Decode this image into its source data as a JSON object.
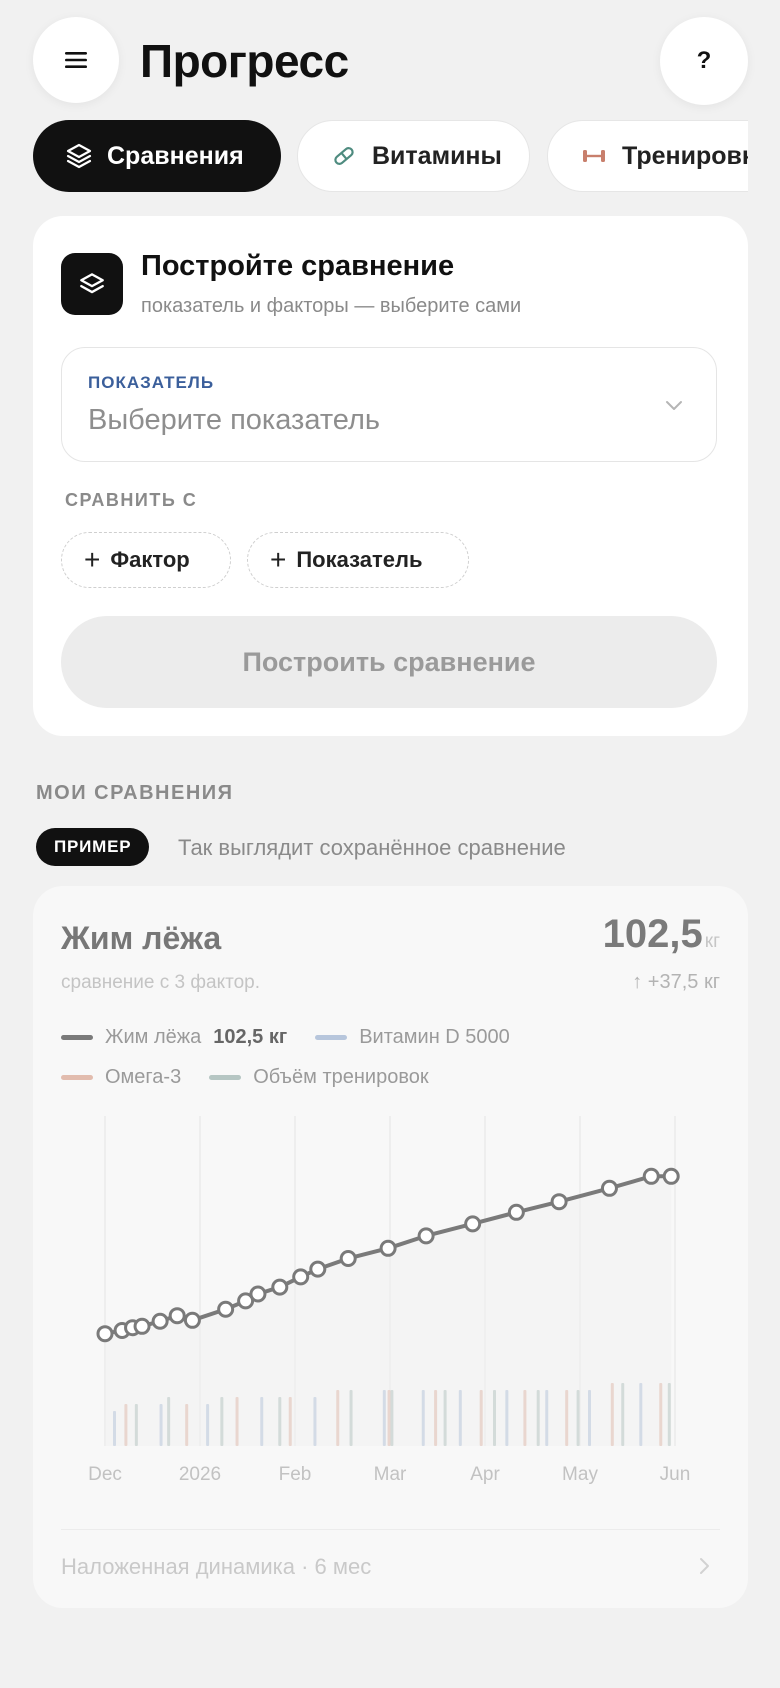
{
  "header": {
    "title": "Прогресс",
    "help": "?"
  },
  "tabs": [
    {
      "label": "Сравнения",
      "icon": "layers-icon"
    },
    {
      "label": "Витамины",
      "icon": "pill-icon"
    },
    {
      "label": "Тренировки",
      "icon": "dumbbell-icon"
    }
  ],
  "builder": {
    "title": "Постройте сравнение",
    "subtitle": "показатель и факторы — выберите сами",
    "metric_label": "ПОКАЗАТЕЛЬ",
    "metric_placeholder": "Выберите показатель",
    "compare_label": "СРАВНИТЬ С",
    "add_factor": "Фактор",
    "add_metric": "Показатель",
    "build_button": "Построить сравнение"
  },
  "my_comparisons": {
    "section_label": "МОИ СРАВНЕНИЯ",
    "badge": "ПРИМЕР",
    "note": "Так выглядит сохранённое сравнение"
  },
  "example": {
    "title": "Жим лёжа",
    "subtitle": "сравнение с 3 фактор.",
    "value": "102,5",
    "unit": "кг",
    "delta": "↑ +37,5 кг",
    "legend": [
      {
        "name": "Жим лёжа",
        "value": "102,5 кг",
        "color": "#7a7a7a"
      },
      {
        "name": "Витамин D 5000",
        "color": "#b7c6dc"
      },
      {
        "name": "Омега-3",
        "color": "#e2bcae"
      },
      {
        "name": "Объём тренировок",
        "color": "#b6c6c3"
      }
    ],
    "footer": "Наложенная динамика · 6 мес"
  },
  "chart_data": {
    "type": "line",
    "x_tick_labels": [
      "Dec",
      "2026",
      "Feb",
      "Mar",
      "Apr",
      "May",
      "Jun"
    ],
    "series": [
      {
        "name": "Жим лёжа",
        "x": [
          0.0,
          0.18,
          0.29,
          0.39,
          0.58,
          0.76,
          0.92,
          1.27,
          1.48,
          1.61,
          1.84,
          2.06,
          2.24,
          2.56,
          2.98,
          3.38,
          3.87,
          4.33,
          4.78,
          5.31,
          5.75,
          5.96
        ],
        "values": [
          65.0,
          65.7,
          66.3,
          66.6,
          67.7,
          68.9,
          67.9,
          70.3,
          72.1,
          73.6,
          75.1,
          77.3,
          79.0,
          81.3,
          83.5,
          86.2,
          88.8,
          91.3,
          93.6,
          96.5,
          99.1,
          99.1
        ]
      },
      {
        "name": "Витамин D 5000",
        "x": [
          0.1,
          0.59,
          1.08,
          1.65,
          2.21,
          2.94,
          3.35,
          3.74,
          4.23,
          4.65,
          5.1,
          5.64
        ],
        "values": [
          0.5,
          0.6,
          0.6,
          0.7,
          0.7,
          0.8,
          0.8,
          0.8,
          0.8,
          0.8,
          0.8,
          0.9
        ]
      },
      {
        "name": "Омега-3",
        "x": [
          0.22,
          0.86,
          1.39,
          1.95,
          2.45,
          2.99,
          3.48,
          3.96,
          4.42,
          4.86,
          5.34,
          5.85
        ],
        "values": [
          0.6,
          0.6,
          0.7,
          0.7,
          0.8,
          0.8,
          0.8,
          0.8,
          0.8,
          0.8,
          0.9,
          0.9
        ]
      },
      {
        "name": "Объём тренировок",
        "x": [
          0.33,
          0.67,
          1.23,
          1.84,
          2.59,
          3.02,
          3.58,
          4.1,
          4.56,
          4.98,
          5.45,
          5.94
        ],
        "values": [
          0.6,
          0.7,
          0.7,
          0.7,
          0.8,
          0.8,
          0.8,
          0.8,
          0.8,
          0.8,
          0.9,
          0.9
        ]
      }
    ],
    "xlim": [
      0,
      6
    ],
    "ylim": [
      45,
      110
    ],
    "grid": "vertical"
  }
}
